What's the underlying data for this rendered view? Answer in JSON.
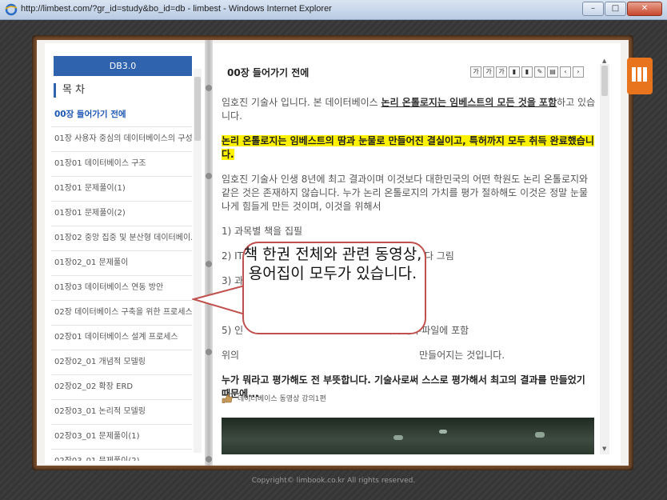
{
  "window": {
    "title": "http://limbest.com/?gr_id=study&bo_id=db - limbest - Windows Internet Explorer"
  },
  "toc": {
    "header": "DB3.0",
    "title": "목 차",
    "items": [
      {
        "label": "00장 들어가기 전에",
        "active": true
      },
      {
        "label": "01장 사용자 중심의 데이터베이스의 구성"
      },
      {
        "label": "01장01 데이터베이스 구조"
      },
      {
        "label": "01장01 문제풀이(1)"
      },
      {
        "label": "01장01 문제풀이(2)"
      },
      {
        "label": "01장02 중앙 집중 및 분산형 데이터베이..."
      },
      {
        "label": "01장02_01 문제풀이"
      },
      {
        "label": "01장03 데이터베이스 연동 방안"
      },
      {
        "label": "02장 데이터베이스 구축을 위한 프로세스"
      },
      {
        "label": "02장01 데이터베이스 설계 프로세스"
      },
      {
        "label": "02장02_01 개념적 모델링"
      },
      {
        "label": "02장02_02 확장 ERD"
      },
      {
        "label": "02장03_01 논리적 모델링"
      },
      {
        "label": "02장03_01 문제풀이(1)"
      },
      {
        "label": "02장03_01 문제풀이(2)"
      }
    ]
  },
  "page": {
    "chapter_title": "00장 들어가기 전에",
    "toolbar": [
      "가",
      "가",
      "가",
      "bookmark-icon",
      "bookmark-icon",
      "edit-icon",
      "print-icon",
      "prev-icon",
      "next-icon"
    ],
    "p1_a": "임호진 기술사 입니다. 본 데이터베이스 ",
    "p1_u": "논리 온톨로지는 임베스트의 모든 것을 포함",
    "p1_b": "하고 있습니다.",
    "p2_hl": "논리 온톨로지는 임베스트의 땀과 눈물로 만들어진 결실이고, 특허까지 모두 취득 완료했습니다.",
    "p3": "임호진 기술사 인생 8년에 최고 결과이며 이것보다 대한민국의 어떤 학원도 논리 온톨로지와 같은 것은 존재하지 않습니다. 누가 논리 온톨로지의 가치를 평가 절하해도 이것은 정말 눈물나게 힘들게 만든 것이며, 이것을 위해서",
    "list": [
      "1) 과목별 책을 집필",
      "2) IT                                           그림을 직접 다 그림",
      "3) 과",
      "4) 녀",
      "5) 인                                           집해서 청부파일에 포함"
    ],
    "p4": "위의                                                           만들어지는 것입니다.",
    "p5": "누가 뭐라고 평가해도 전 부뜻합니다. 기술사로써 스스로 평가해서 최고의 결과를 만들었기 때문에...",
    "video_label": "데이터베이스 동영상 강의1편"
  },
  "callout": {
    "text": "책 한권 전체와 관련 동영상, 용어집이 모두가 있습니다."
  },
  "footer": "Copyright© limbook.co.kr All rights reserved.",
  "colors": {
    "toc_header": "#2f63ae",
    "highlight": "#fff200",
    "callout_border": "#c0504d",
    "library_icon": "#e8741e"
  }
}
